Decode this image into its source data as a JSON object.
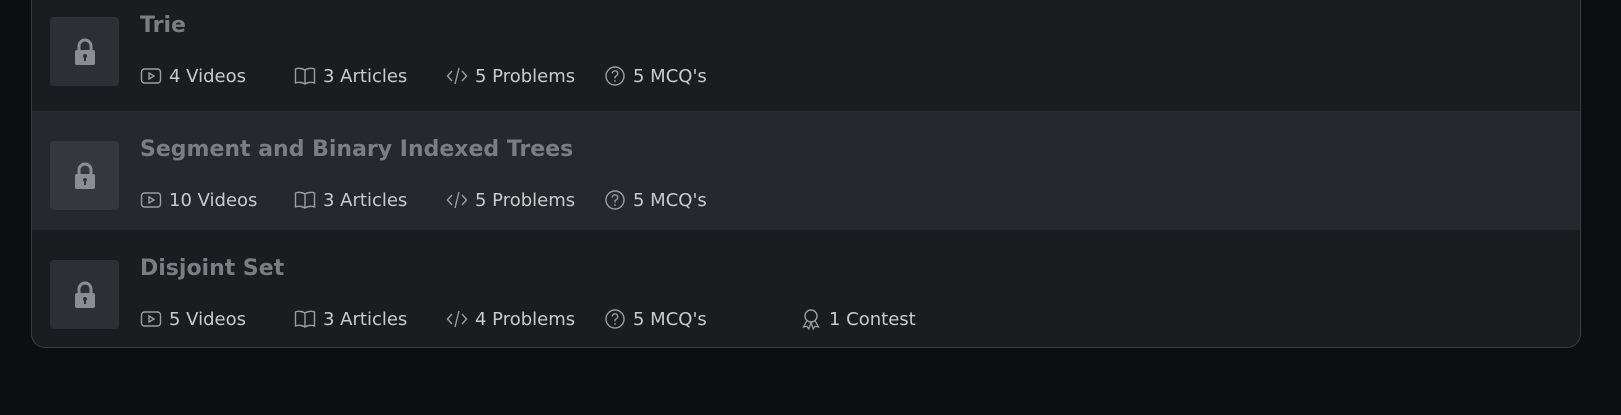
{
  "modules": [
    {
      "title": "Trie",
      "stats": [
        {
          "icon": "video-icon",
          "text": "4 Videos"
        },
        {
          "icon": "book-icon",
          "text": "3 Articles"
        },
        {
          "icon": "code-icon",
          "text": "5 Problems"
        },
        {
          "icon": "question-icon",
          "text": "5 MCQ's"
        }
      ]
    },
    {
      "title": "Segment and Binary Indexed Trees",
      "stats": [
        {
          "icon": "video-icon",
          "text": "10 Videos"
        },
        {
          "icon": "book-icon",
          "text": "3 Articles"
        },
        {
          "icon": "code-icon",
          "text": "5 Problems"
        },
        {
          "icon": "question-icon",
          "text": "5 MCQ's"
        }
      ]
    },
    {
      "title": "Disjoint Set",
      "stats": [
        {
          "icon": "video-icon",
          "text": "5 Videos"
        },
        {
          "icon": "book-icon",
          "text": "3 Articles"
        },
        {
          "icon": "code-icon",
          "text": "4 Problems"
        },
        {
          "icon": "question-icon",
          "text": "5 MCQ's"
        },
        {
          "icon": "award-icon",
          "text": "1 Contest"
        }
      ]
    }
  ]
}
